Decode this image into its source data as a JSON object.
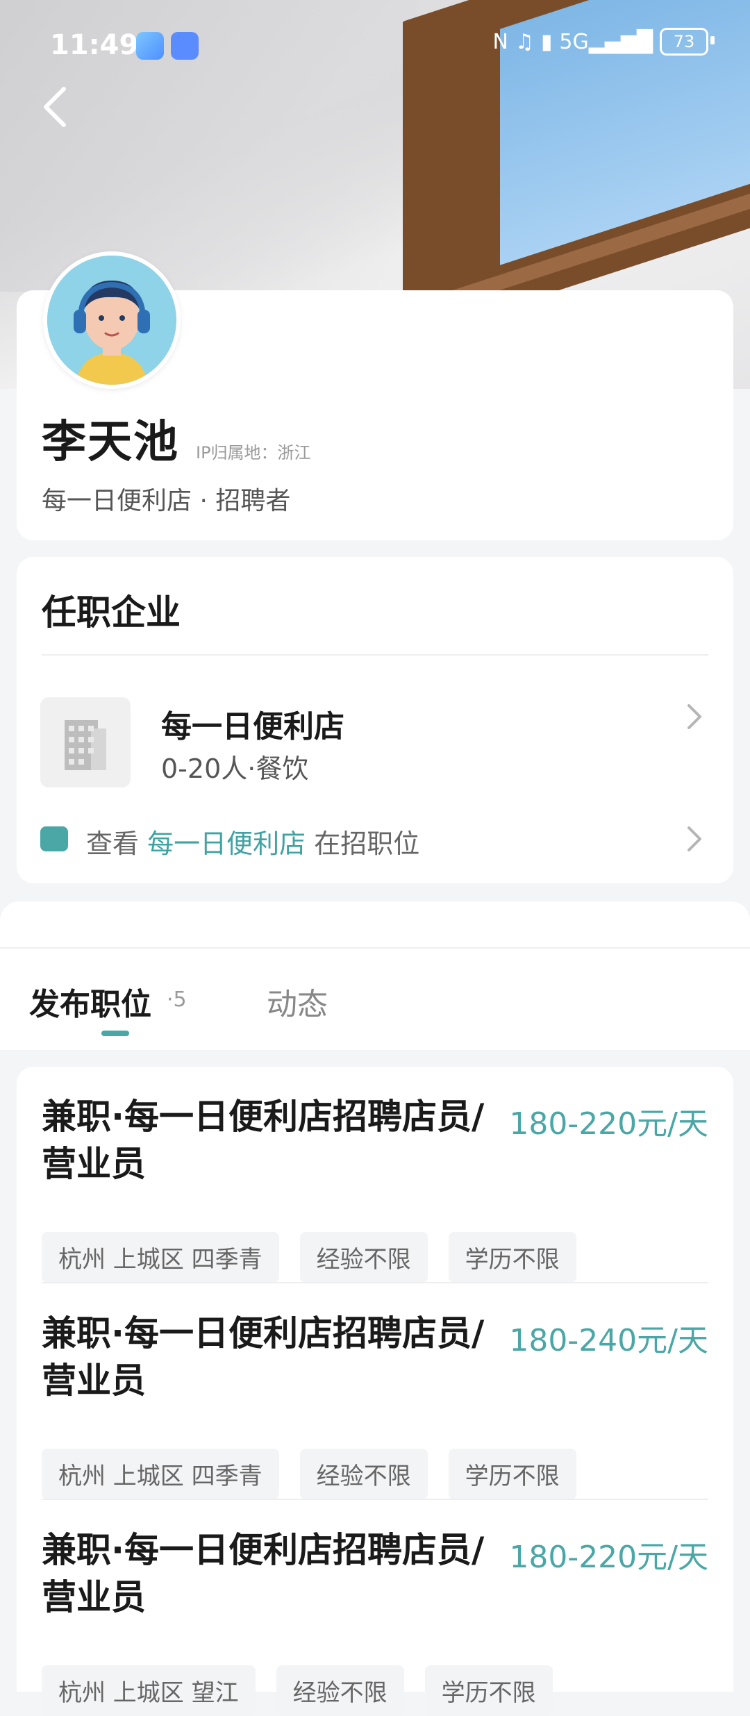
{
  "status_bar": {
    "time": "11:49",
    "battery": "73"
  },
  "profile": {
    "name": "李天池",
    "ip_location": "IP归属地：浙江",
    "role": "每一日便利店 · 招聘者"
  },
  "company_section": {
    "title": "任职企业",
    "company_name": "每一日便利店",
    "company_meta": "0-20人·餐饮",
    "view_prefix": "查看",
    "view_company": "每一日便利店",
    "view_suffix": "在招职位"
  },
  "tabs": {
    "active_label": "发布职位",
    "active_count": "·5",
    "inactive_label": "动态"
  },
  "jobs": [
    {
      "title": "兼职·每一日便利店招聘店员/营业员",
      "salary": "180-220元/天",
      "tags": [
        "杭州 上城区 四季青",
        "经验不限",
        "学历不限"
      ]
    },
    {
      "title": "兼职·每一日便利店招聘店员/营业员",
      "salary": "180-240元/天",
      "tags": [
        "杭州 上城区 四季青",
        "经验不限",
        "学历不限"
      ]
    },
    {
      "title": "兼职·每一日便利店招聘店员/营业员",
      "salary": "180-220元/天",
      "tags": [
        "杭州 上城区 望江",
        "经验不限",
        "学历不限"
      ]
    }
  ],
  "colors": {
    "accent": "#4aa7a5",
    "background": "#f4f5f7"
  }
}
